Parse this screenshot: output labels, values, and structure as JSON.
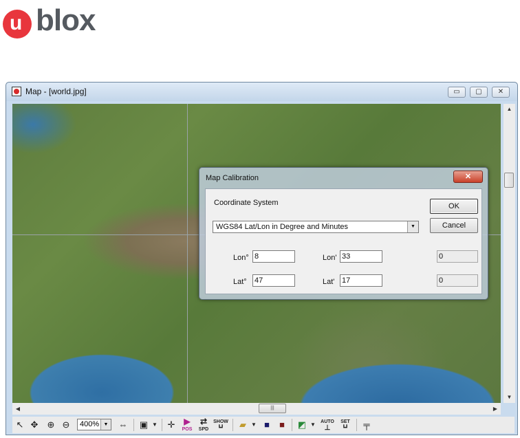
{
  "brand": {
    "logo_text": "blox",
    "logo_u": "u",
    "brand_color": "#e8363d"
  },
  "window": {
    "title": "Map - [world.jpg]"
  },
  "window_controls": {
    "minimize": "▭",
    "maximize": "▢",
    "close": "✕"
  },
  "dialog": {
    "title": "Map Calibration",
    "close": "✕",
    "coordinate_label": "Coordinate System",
    "coordinate_value": "WGS84 Lat/Lon in Degree and Minutes",
    "ok": "OK",
    "cancel": "Cancel",
    "rows": [
      {
        "deg_label": "Lon°",
        "deg_value": "8",
        "min_label": "Lon'",
        "min_value": "33",
        "sec_value": "0"
      },
      {
        "deg_label": "Lat°",
        "deg_value": "47",
        "min_label": "Lat'",
        "min_value": "17",
        "sec_value": "0"
      }
    ]
  },
  "toolbar": {
    "zoom": "400%",
    "auto": "AUTO",
    "set": "SET",
    "show": "SHOW",
    "spd": "SPD",
    "pos": "POS"
  }
}
